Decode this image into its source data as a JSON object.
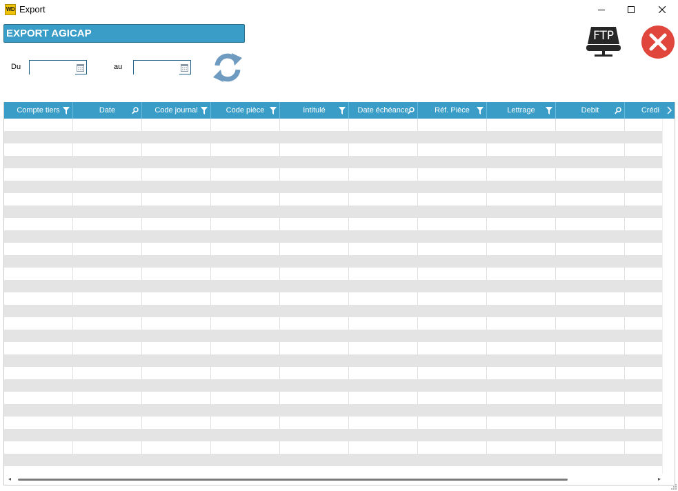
{
  "window": {
    "app_icon_text": "WD",
    "title": "Export",
    "icons": {
      "minimize": "minimize-icon",
      "maximize": "maximize-icon",
      "close": "window-close-icon"
    }
  },
  "header": {
    "title": "EXPORT AGICAP"
  },
  "filters": {
    "from_label": "Du",
    "from_value": "",
    "to_label": "au",
    "to_value": "",
    "calendar_icon": "calendar-icon",
    "refresh_icon": "refresh-icon"
  },
  "actions": {
    "ftp_label": "FTP",
    "ftp_icon": "ftp-server-icon",
    "close_icon": "close-circle-icon"
  },
  "colors": {
    "accent": "#3a9dc8",
    "close_red": "#e0463b",
    "refresh_blue": "#6f9bc0",
    "row_alt": "#e4e4e4"
  },
  "table": {
    "columns": [
      {
        "label": "Compte tiers",
        "icon": "filter"
      },
      {
        "label": "Date",
        "icon": "search"
      },
      {
        "label": "Code journal",
        "icon": "filter"
      },
      {
        "label": "Code pièce",
        "icon": "filter"
      },
      {
        "label": "Intitulé",
        "icon": "filter"
      },
      {
        "label": "Date échéance",
        "icon": "search"
      },
      {
        "label": "Réf. Pièce",
        "icon": "filter"
      },
      {
        "label": "Lettrage",
        "icon": "filter"
      },
      {
        "label": "Debit",
        "icon": "search"
      },
      {
        "label": "Crédi",
        "icon": ""
      }
    ],
    "rows": []
  }
}
